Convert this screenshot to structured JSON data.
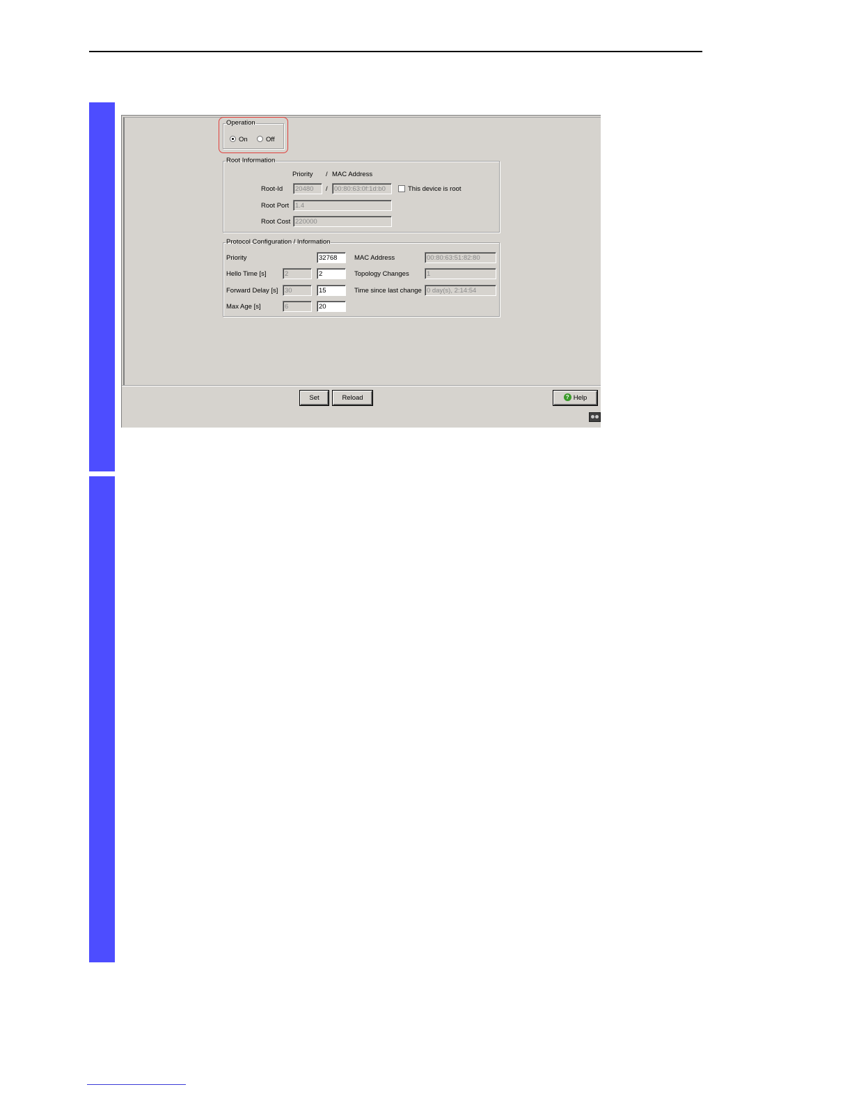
{
  "operation": {
    "legend": "Operation",
    "on_label": "On",
    "off_label": "Off",
    "selected": "On"
  },
  "root_info": {
    "legend": "Root Information",
    "col_priority": "Priority",
    "col_sep": "/",
    "col_mac": "MAC Address",
    "root_id_label": "Root-Id",
    "root_id_priority": "20480",
    "root_id_sep": "/",
    "root_id_mac": "00:80:63:0f:1d:b0",
    "this_device_is_root_label": "This device is root",
    "root_port_label": "Root Port",
    "root_port_value": "1.4",
    "root_cost_label": "Root Cost",
    "root_cost_value": "220000"
  },
  "protocol": {
    "legend": "Protocol Configuration / Information",
    "priority_label": "Priority",
    "priority_value": "32768",
    "hello_time_label": "Hello Time [s]",
    "hello_time_current": "2",
    "hello_time_value": "2",
    "forward_delay_label": "Forward Delay [s]",
    "forward_delay_current": "30",
    "forward_delay_value": "15",
    "max_age_label": "Max Age [s]",
    "max_age_current": "6",
    "max_age_value": "20",
    "mac_address_label": "MAC Address",
    "mac_address_value": "00:80:63:51:82:80",
    "topology_changes_label": "Topology Changes",
    "topology_changes_value": "1",
    "time_since_label": "Time since last change",
    "time_since_value": "0 day(s), 2:14:54"
  },
  "buttons": {
    "set": "Set",
    "reload": "Reload",
    "help": "Help"
  },
  "colors": {
    "accent_bar": "#4d4dff",
    "highlight": "#e0403c"
  }
}
